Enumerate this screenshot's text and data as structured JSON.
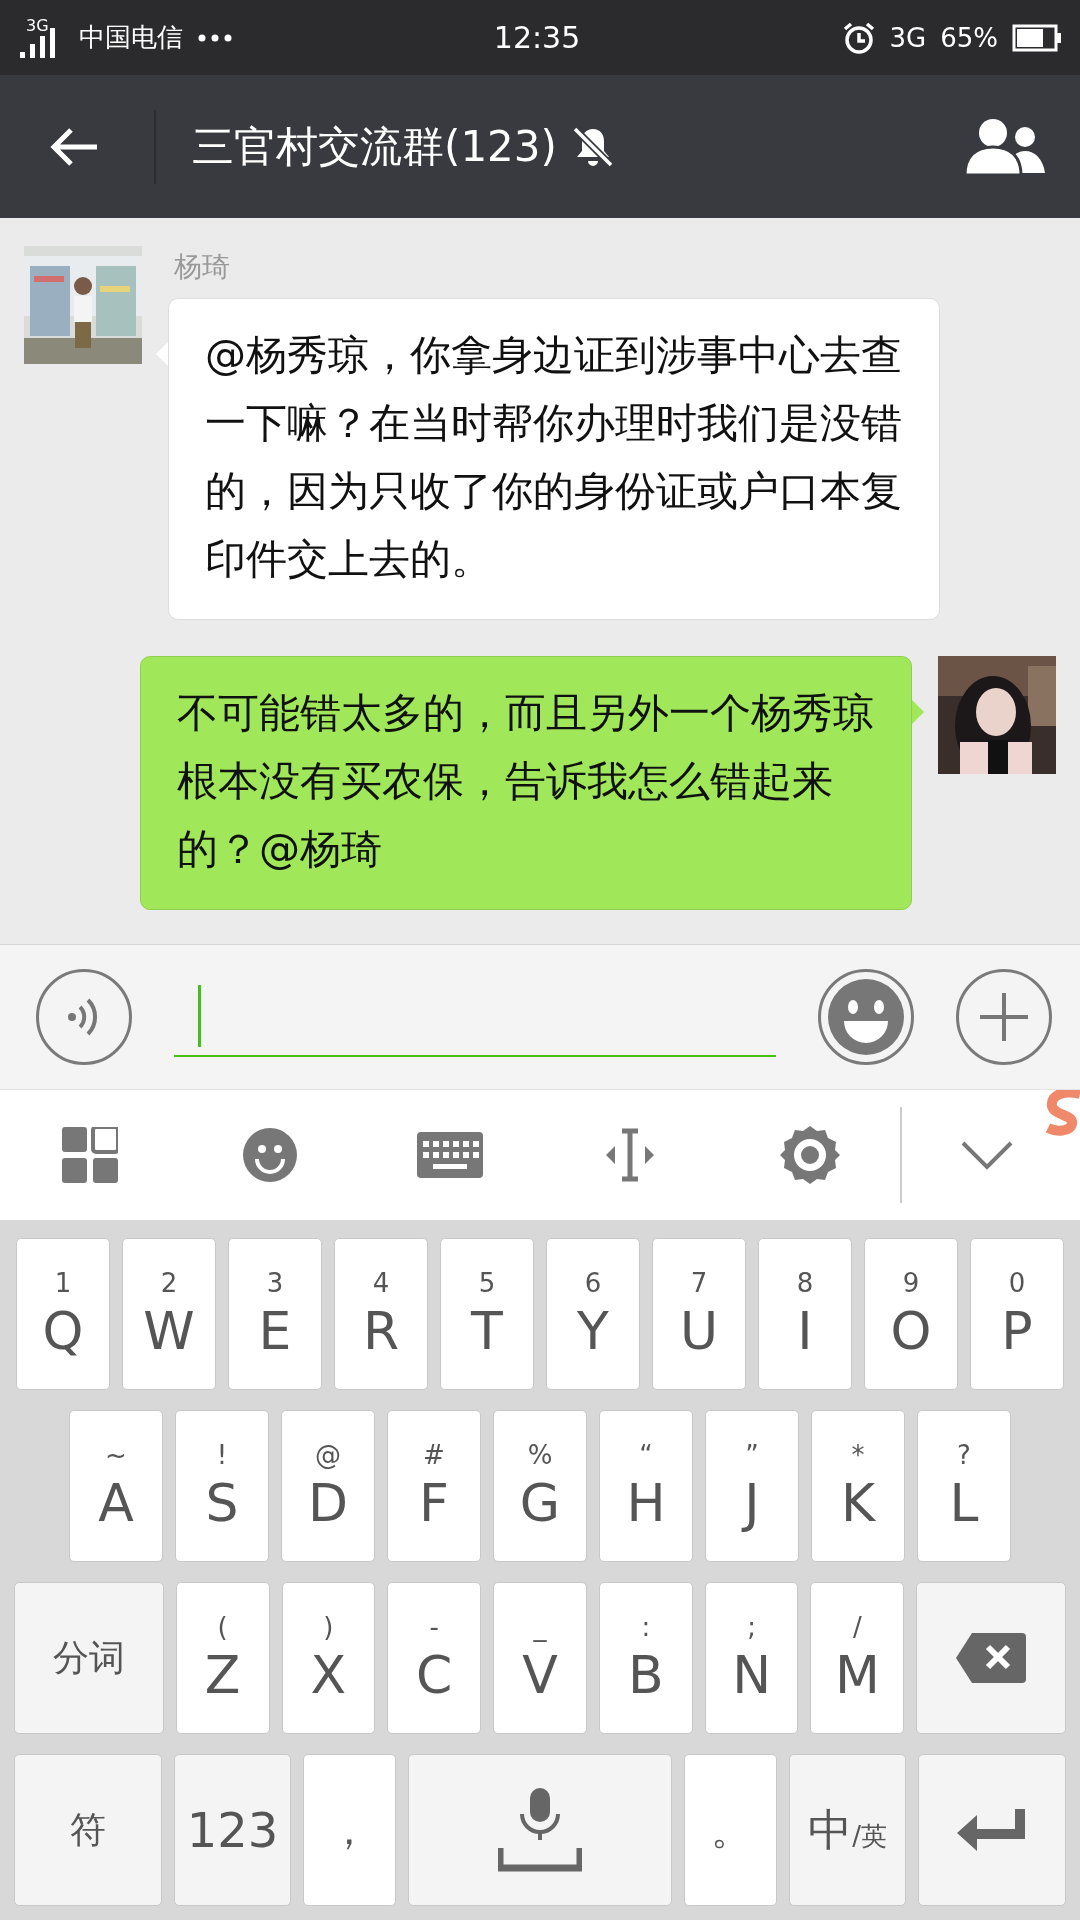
{
  "status_bar": {
    "network_tag": "3G",
    "carrier": "中国电信",
    "time": "12:35",
    "network": "3G",
    "battery": "65%"
  },
  "header": {
    "title": "三官村交流群(123)",
    "muted": true
  },
  "messages": [
    {
      "kind": "received",
      "sender": "杨琦",
      "text": "@杨秀琼，你拿身边证到涉事中心去查一下嘛？在当时帮你办理时我们是没错的，因为只收了你的身份证或户口本复印件交上去的。"
    },
    {
      "kind": "sent",
      "text": "不可能错太多的，而且另外一个杨秀琼根本没有买农保，告诉我怎么错起来的？@杨琦"
    }
  ],
  "input_bar": {
    "focused": true
  },
  "keyboard": {
    "rows": [
      {
        "keys": [
          {
            "kind": "letter",
            "hint": "1",
            "label": "Q"
          },
          {
            "kind": "letter",
            "hint": "2",
            "label": "W"
          },
          {
            "kind": "letter",
            "hint": "3",
            "label": "E"
          },
          {
            "kind": "letter",
            "hint": "4",
            "label": "R"
          },
          {
            "kind": "letter",
            "hint": "5",
            "label": "T"
          },
          {
            "kind": "letter",
            "hint": "6",
            "label": "Y"
          },
          {
            "kind": "letter",
            "hint": "7",
            "label": "U"
          },
          {
            "kind": "letter",
            "hint": "8",
            "label": "I"
          },
          {
            "kind": "letter",
            "hint": "9",
            "label": "O"
          },
          {
            "kind": "letter",
            "hint": "0",
            "label": "P"
          }
        ]
      },
      {
        "keys": [
          {
            "kind": "letter",
            "hint": "~",
            "label": "A"
          },
          {
            "kind": "letter",
            "hint": "!",
            "label": "S"
          },
          {
            "kind": "letter",
            "hint": "@",
            "label": "D"
          },
          {
            "kind": "letter",
            "hint": "#",
            "label": "F"
          },
          {
            "kind": "letter",
            "hint": "%",
            "label": "G"
          },
          {
            "kind": "letter",
            "hint": "“",
            "label": "H"
          },
          {
            "kind": "letter",
            "hint": "”",
            "label": "J"
          },
          {
            "kind": "letter",
            "hint": "*",
            "label": "K"
          },
          {
            "kind": "letter",
            "hint": "?",
            "label": "L"
          }
        ]
      },
      {
        "keys": [
          {
            "kind": "function",
            "label": "分词"
          },
          {
            "kind": "letter",
            "hint": "(",
            "label": "Z"
          },
          {
            "kind": "letter",
            "hint": ")",
            "label": "X"
          },
          {
            "kind": "letter",
            "hint": "-",
            "label": "C"
          },
          {
            "kind": "letter",
            "hint": "_",
            "label": "V"
          },
          {
            "kind": "letter",
            "hint": ":",
            "label": "B"
          },
          {
            "kind": "letter",
            "hint": ";",
            "label": "N"
          },
          {
            "kind": "letter",
            "hint": "/",
            "label": "M"
          },
          {
            "kind": "delete"
          }
        ]
      },
      {
        "keys": [
          {
            "kind": "function",
            "label": "符"
          },
          {
            "kind": "function",
            "label": "123"
          },
          {
            "kind": "char",
            "label": "，"
          },
          {
            "kind": "space"
          },
          {
            "kind": "char",
            "label": "。"
          },
          {
            "kind": "lang",
            "label": "中",
            "sub": "/英"
          },
          {
            "kind": "enter"
          }
        ]
      }
    ]
  }
}
